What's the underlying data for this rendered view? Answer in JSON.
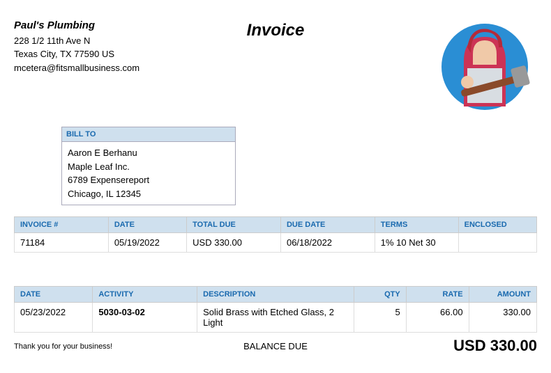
{
  "company": {
    "name": "Paul's Plumbing",
    "addr1": "228 1/2 11th Ave N",
    "addr2": "Texas City, TX  77590 US",
    "email": "mcetera@fitsmallbusiness.com"
  },
  "doc_title": "Invoice",
  "bill_to": {
    "header": "BILL TO",
    "name": "Aaron E Berhanu",
    "org": "Maple Leaf Inc.",
    "addr1": "6789 Expensereport",
    "addr2": "Chicago, IL  12345"
  },
  "meta": {
    "headers": {
      "invoice_no": "INVOICE #",
      "date": "DATE",
      "total_due": "TOTAL DUE",
      "due_date": "DUE DATE",
      "terms": "TERMS",
      "enclosed": "ENCLOSED"
    },
    "invoice_no": "71184",
    "date": "05/19/2022",
    "total_due": "USD 330.00",
    "due_date": "06/18/2022",
    "terms": "1% 10 Net 30",
    "enclosed": ""
  },
  "items": {
    "headers": {
      "date": "DATE",
      "activity": "ACTIVITY",
      "description": "DESCRIPTION",
      "qty": "QTY",
      "rate": "RATE",
      "amount": "AMOUNT"
    },
    "rows": [
      {
        "date": "05/23/2022",
        "activity": "5030-03-02",
        "description": "Solid Brass with Etched Glass, 2 Light",
        "qty": "5",
        "rate": "66.00",
        "amount": "330.00"
      }
    ]
  },
  "footer": {
    "thanks": "Thank you for your business!",
    "balance_label": "BALANCE DUE",
    "balance_value": "USD 330.00"
  }
}
